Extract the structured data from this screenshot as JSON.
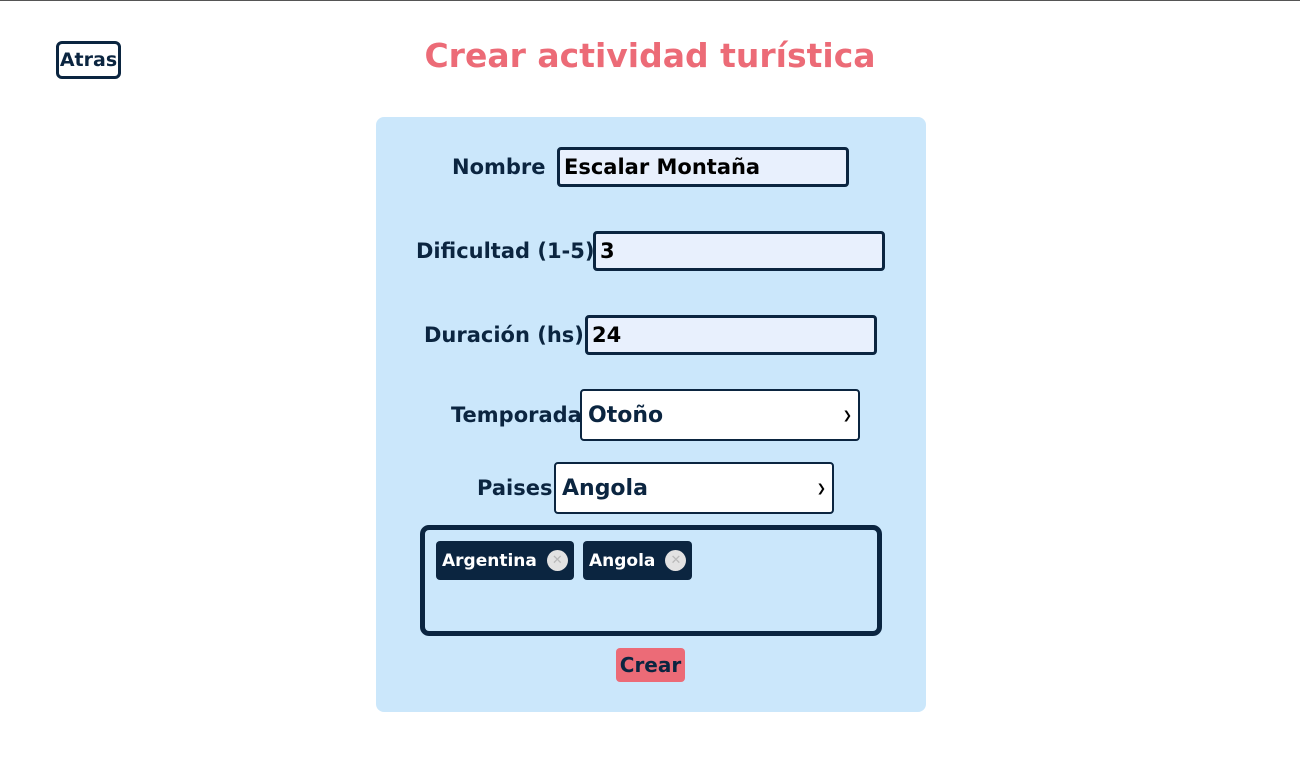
{
  "header": {
    "back_label": "Atras",
    "title": "Crear actividad turística"
  },
  "form": {
    "nombre": {
      "label": "Nombre",
      "value": "Escalar Montaña"
    },
    "dificultad": {
      "label": "Dificultad (1-5)",
      "value": "3"
    },
    "duracion": {
      "label": "Duración (hs)",
      "value": "24"
    },
    "temporada": {
      "label": "Temporada",
      "selected": "Otoño"
    },
    "paises": {
      "label": "Paises",
      "selected": "Angola",
      "chips": [
        {
          "label": "Argentina",
          "remove_icon": "close-icon"
        },
        {
          "label": "Angola",
          "remove_icon": "close-icon"
        }
      ]
    },
    "submit_label": "Crear"
  },
  "colors": {
    "accent": "#ec6b77",
    "navy": "#0b2540",
    "panel": "#cbe7fb",
    "input_bg": "#e8f0fd"
  }
}
